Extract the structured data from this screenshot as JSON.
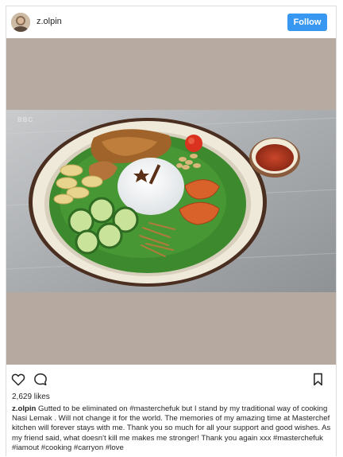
{
  "post": {
    "username": "z.olpin",
    "follow_label": "Follow",
    "media_overlay": "BBC",
    "likes": "2,629 likes",
    "caption_username": "z.olpin",
    "caption_text": "Gutted to be eliminated on #masterchefuk but I stand by my traditional way of cooking Nasi Lemak . Will not change it for the world. The memories of my amazing time at Masterchef kitchen will forever stays with me. Thank you so much for all your support and good wishes. As my friend said, what doesn't kill me makes me stronger! Thank you again xxx #masterchefuk #iamout #cooking #carryon #love"
  },
  "colors": {
    "follow_button": "#3897f0",
    "media_background": "#b6aaa1",
    "text": "#262626"
  },
  "icons": {
    "like": "heart-icon",
    "comment": "comment-bubble-icon",
    "save": "bookmark-icon"
  }
}
